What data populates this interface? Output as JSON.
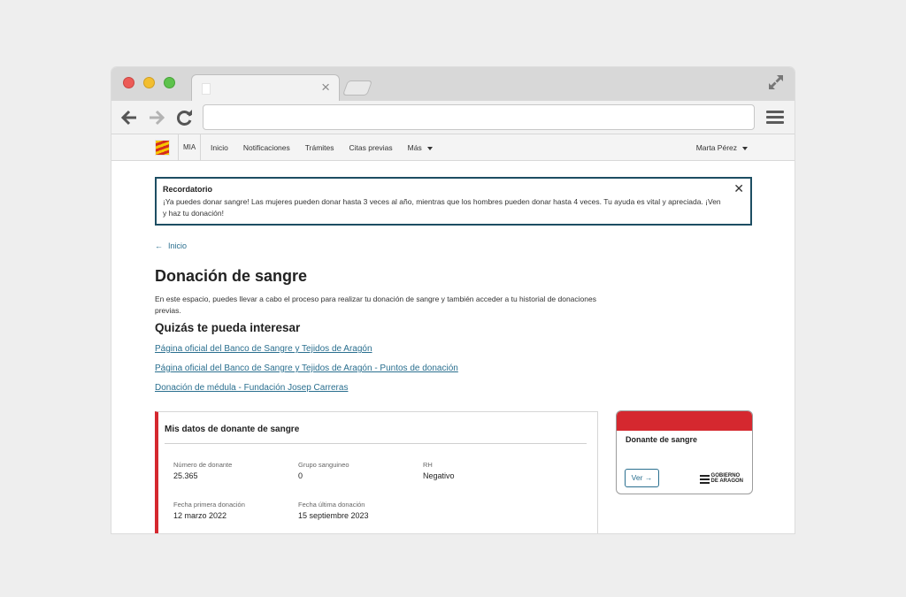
{
  "header": {
    "mia": "MIA",
    "nav": [
      "Inicio",
      "Notificaciones",
      "Trámites",
      "Citas previas",
      "Más"
    ],
    "user": "Marta Pérez"
  },
  "alert": {
    "title": "Recordatorio",
    "text": "¡Ya puedes donar sangre! Las mujeres pueden donar hasta 3 veces al año, mientras que los hombres pueden donar hasta 4 veces. Tu ayuda es vital y apreciada. ¡Ven y haz tu donación!",
    "close": "✕"
  },
  "breadcrumb": {
    "arrow": "←",
    "label": "Inicio"
  },
  "page": {
    "title": "Donación de sangre",
    "intro": "En este espacio, puedes llevar a cabo el proceso para realizar tu donación de sangre y también acceder a tu historial de donaciones previas.",
    "subtitle": "Quizás te pueda interesar",
    "links": [
      "Página oficial del Banco de Sangre y Tejidos de Aragón",
      "Página oficial del Banco de Sangre y Tejidos de Aragón - Puntos de donación",
      "Donación de médula - Fundación Josep Carreras"
    ]
  },
  "donor_data": {
    "title": "Mis datos de donante de sangre",
    "fields": [
      {
        "label": "Número de donante",
        "value": "25.365"
      },
      {
        "label": "Grupo sanguineo",
        "value": "0"
      },
      {
        "label": "RH",
        "value": "Negativo"
      },
      {
        "label": "Fecha primera donación",
        "value": "12 marzo 2022"
      },
      {
        "label": "Fecha última donación",
        "value": "15 septiembre 2023"
      }
    ]
  },
  "donor_card": {
    "title": "Donante de sangre",
    "button": "Ver",
    "button_arrow": "→",
    "logo_line1": "GOBIERNO",
    "logo_line2": "DE ARAGON"
  },
  "colors": {
    "accent_red": "#d5282f",
    "link_blue": "#2a6f8f",
    "alert_border": "#1d4e63"
  },
  "icons": [
    "back-arrow-icon",
    "forward-arrow-icon",
    "reload-icon",
    "menu-icon",
    "expand-icon",
    "close-icon",
    "caret-down-icon"
  ]
}
